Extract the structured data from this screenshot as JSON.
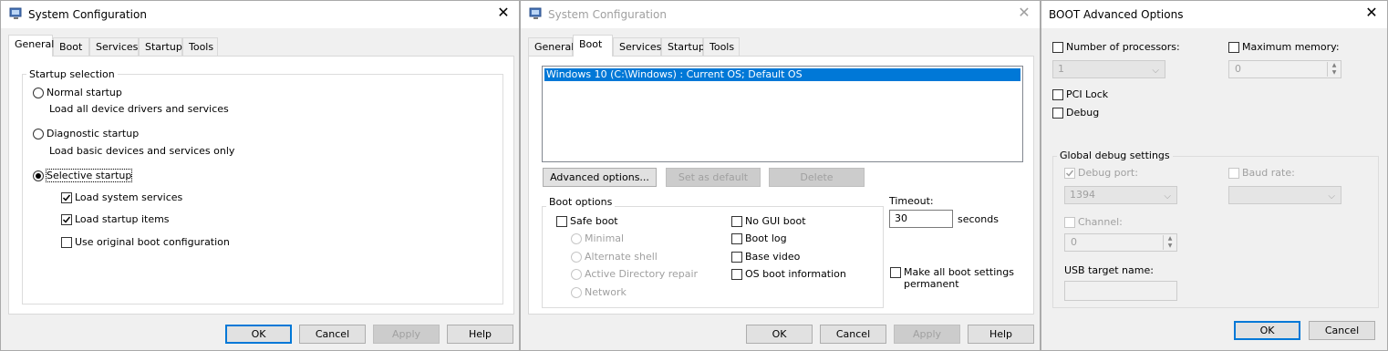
{
  "win1": {
    "title": "System Configuration",
    "tabs": [
      "General",
      "Boot",
      "Services",
      "Startup",
      "Tools"
    ],
    "startup_group": "Startup selection",
    "normal_label": "Normal startup",
    "normal_desc": "Load all device drivers and services",
    "diag_label": "Diagnostic startup",
    "diag_desc": "Load basic devices and services only",
    "selective_label": "Selective startup",
    "load_system": "Load system services",
    "load_startup": "Load startup items",
    "use_original": "Use original boot configuration",
    "ok": "OK",
    "cancel": "Cancel",
    "apply": "Apply",
    "help": "Help"
  },
  "win2": {
    "title": "System Configuration",
    "tabs": [
      "General",
      "Boot",
      "Services",
      "Startup",
      "Tools"
    ],
    "os_entry": "Windows 10 (C:\\Windows) : Current OS; Default OS",
    "advanced": "Advanced options...",
    "set_default": "Set as default",
    "delete": "Delete",
    "boot_options": "Boot options",
    "safe_boot": "Safe boot",
    "minimal": "Minimal",
    "alt_shell": "Alternate shell",
    "ad_repair": "Active Directory repair",
    "network": "Network",
    "no_gui": "No GUI boot",
    "boot_log": "Boot log",
    "base_video": "Base video",
    "os_info": "OS boot information",
    "timeout_label": "Timeout:",
    "timeout_value": "30",
    "seconds": "seconds",
    "make_perm_1": "Make all boot settings",
    "make_perm_2": "permanent",
    "ok": "OK",
    "cancel": "Cancel",
    "apply": "Apply",
    "help": "Help"
  },
  "win3": {
    "title": "BOOT Advanced Options",
    "num_proc": "Number of processors:",
    "num_proc_value": "1",
    "max_mem": "Maximum memory:",
    "max_mem_value": "0",
    "pci_lock": "PCI Lock",
    "debug": "Debug",
    "global_debug": "Global debug settings",
    "debug_port": "Debug port:",
    "debug_port_value": "1394",
    "baud_rate": "Baud rate:",
    "channel": "Channel:",
    "channel_value": "0",
    "usb_target": "USB target name:",
    "ok": "OK",
    "cancel": "Cancel"
  }
}
